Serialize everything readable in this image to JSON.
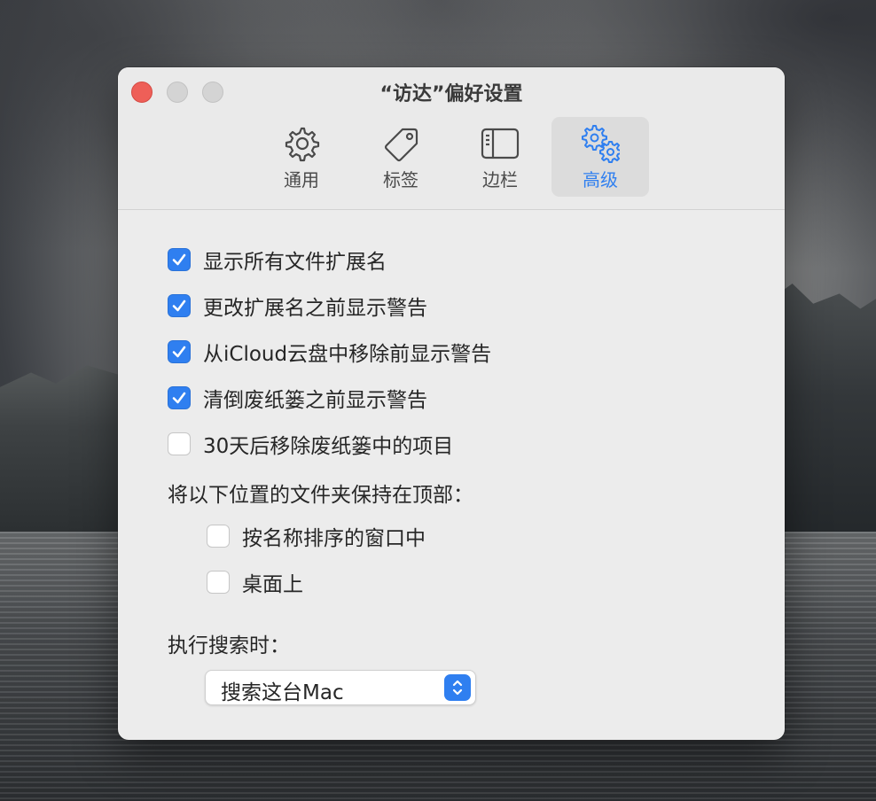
{
  "window": {
    "title": "“访达”偏好设置"
  },
  "toolbar": {
    "tabs": [
      {
        "label": "通用",
        "icon": "gear-icon",
        "active": false
      },
      {
        "label": "标签",
        "icon": "tag-icon",
        "active": false
      },
      {
        "label": "边栏",
        "icon": "sidebar-icon",
        "active": false
      },
      {
        "label": "高级",
        "icon": "gears-icon",
        "active": true
      }
    ]
  },
  "options": [
    {
      "label": "显示所有文件扩展名",
      "checked": true
    },
    {
      "label": "更改扩展名之前显示警告",
      "checked": true
    },
    {
      "label": "从iCloud云盘中移除前显示警告",
      "checked": true
    },
    {
      "label": "清倒废纸篓之前显示警告",
      "checked": true
    },
    {
      "label": "30天后移除废纸篓中的项目",
      "checked": false
    }
  ],
  "folders_on_top": {
    "label": "将以下位置的文件夹保持在顶部：",
    "options": [
      {
        "label": "按名称排序的窗口中",
        "checked": false
      },
      {
        "label": "桌面上",
        "checked": false
      }
    ]
  },
  "search": {
    "label": "执行搜索时：",
    "selected": "搜索这台Mac"
  },
  "colors": {
    "accent": "#2f7ff0",
    "close": "#ee5f58",
    "window_bg": "#ececec"
  }
}
